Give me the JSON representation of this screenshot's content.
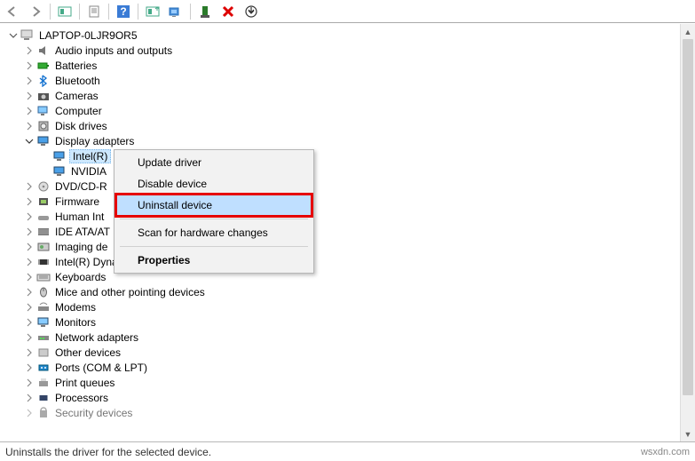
{
  "toolbar": {
    "buttons": [
      "back",
      "forward",
      "show-hidden",
      "properties",
      "help",
      "update",
      "scan",
      "add-legacy",
      "remove",
      "more"
    ]
  },
  "tree": {
    "root": {
      "label": "LAPTOP-0LJR9OR5",
      "expanded": true
    },
    "categories": [
      {
        "label": "Audio inputs and outputs",
        "icon": "audio",
        "expanded": false
      },
      {
        "label": "Batteries",
        "icon": "battery",
        "expanded": false
      },
      {
        "label": "Bluetooth",
        "icon": "bluetooth",
        "expanded": false
      },
      {
        "label": "Cameras",
        "icon": "camera",
        "expanded": false
      },
      {
        "label": "Computer",
        "icon": "computer",
        "expanded": false
      },
      {
        "label": "Disk drives",
        "icon": "disk",
        "expanded": false
      },
      {
        "label": "Display adapters",
        "icon": "display",
        "expanded": true,
        "children": [
          {
            "label": "Intel(R)",
            "icon": "display",
            "selected": true
          },
          {
            "label": "NVIDIA",
            "icon": "display",
            "selected": false
          }
        ]
      },
      {
        "label": "DVD/CD-R",
        "icon": "dvd",
        "expanded": false,
        "truncated": true
      },
      {
        "label": "Firmware",
        "icon": "firmware",
        "expanded": false,
        "truncated": true
      },
      {
        "label": "Human Int",
        "icon": "hid",
        "expanded": false,
        "truncated": true
      },
      {
        "label": "IDE ATA/AT",
        "icon": "ide",
        "expanded": false,
        "truncated": true
      },
      {
        "label": "Imaging de",
        "icon": "imaging",
        "expanded": false,
        "truncated": true
      },
      {
        "label": "Intel(R) Dynamic Platform and Thermal Framework",
        "icon": "chip",
        "expanded": false
      },
      {
        "label": "Keyboards",
        "icon": "keyboard",
        "expanded": false
      },
      {
        "label": "Mice and other pointing devices",
        "icon": "mouse",
        "expanded": false
      },
      {
        "label": "Modems",
        "icon": "modem",
        "expanded": false
      },
      {
        "label": "Monitors",
        "icon": "monitor",
        "expanded": false
      },
      {
        "label": "Network adapters",
        "icon": "network",
        "expanded": false
      },
      {
        "label": "Other devices",
        "icon": "other",
        "expanded": false
      },
      {
        "label": "Ports (COM & LPT)",
        "icon": "port",
        "expanded": false
      },
      {
        "label": "Print queues",
        "icon": "printer",
        "expanded": false
      },
      {
        "label": "Processors",
        "icon": "cpu",
        "expanded": false
      },
      {
        "label": "Security devices",
        "icon": "security",
        "expanded": false,
        "cut": true
      }
    ]
  },
  "context_menu": {
    "items": [
      {
        "label": "Update driver",
        "type": "item"
      },
      {
        "label": "Disable device",
        "type": "item"
      },
      {
        "label": "Uninstall device",
        "type": "item",
        "hover": true,
        "highlight": true
      },
      {
        "type": "sep"
      },
      {
        "label": "Scan for hardware changes",
        "type": "item"
      },
      {
        "type": "sep"
      },
      {
        "label": "Properties",
        "type": "item",
        "bold": true
      }
    ]
  },
  "statusbar": {
    "text": "Uninstalls the driver for the selected device.",
    "watermark": "wsxdn.com"
  }
}
